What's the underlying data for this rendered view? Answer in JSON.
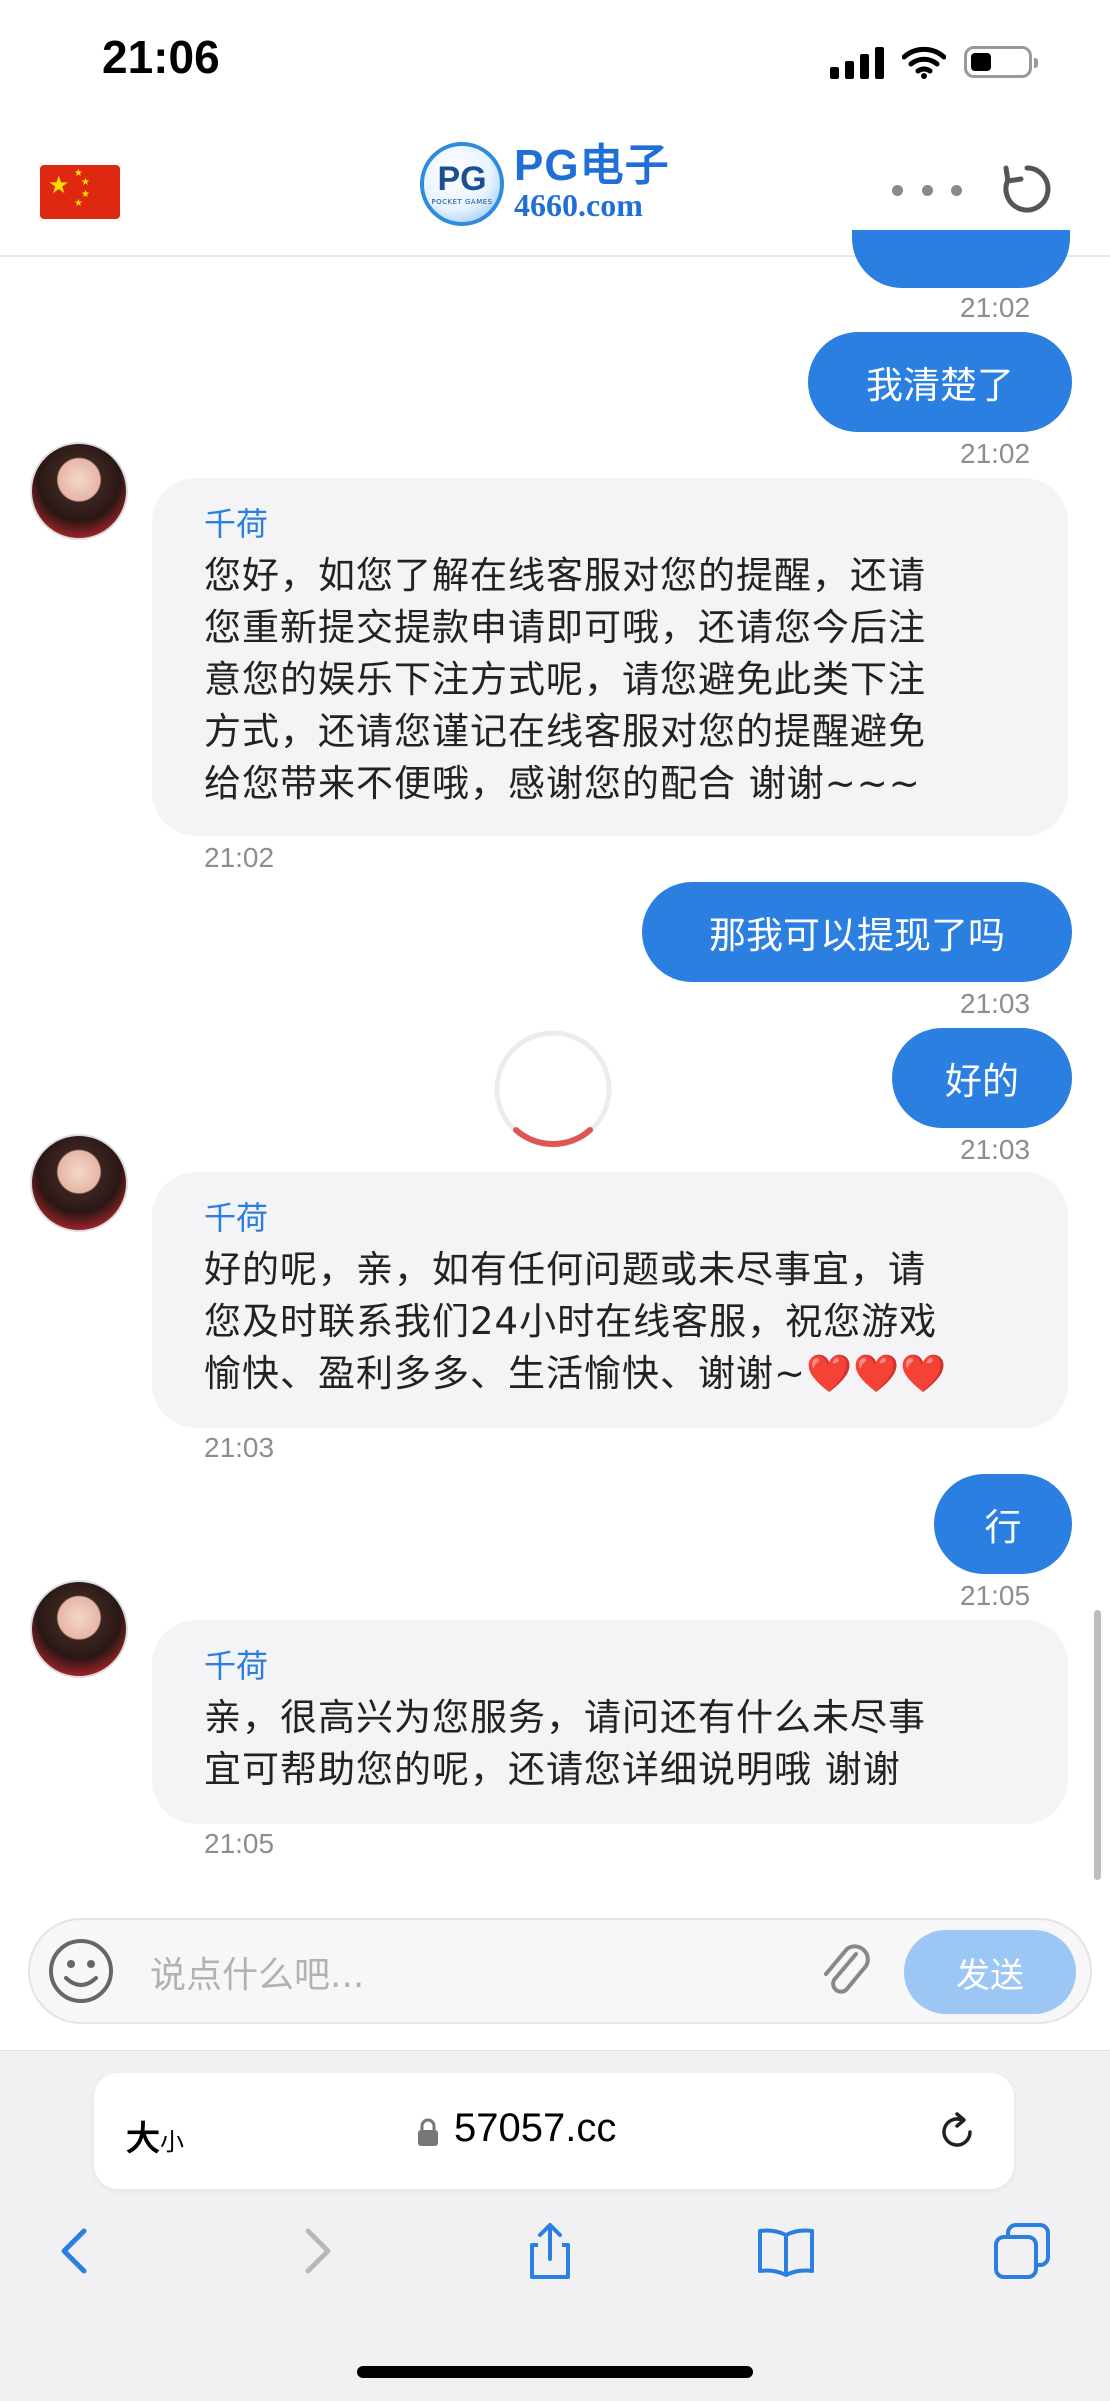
{
  "status_bar": {
    "time": "21:06"
  },
  "header": {
    "flag_icon": "china-flag-icon",
    "logo_badge": "PG",
    "logo_badge_sub": "POCKET GAMES",
    "logo_title": "PG电子",
    "logo_domain": "4660.com"
  },
  "messages": [
    {
      "type": "outgoing",
      "text": "",
      "time": "21:02"
    },
    {
      "type": "outgoing",
      "text": "我清楚了",
      "time": "21:02"
    },
    {
      "type": "incoming",
      "name": "千荷",
      "lines": [
        "您好，如您了解在线客服对您的提醒，还请",
        "您重新提交提款申请即可哦，还请您今后注",
        "意您的娱乐下注方式呢，请您避免此类下注",
        "方式，还请您谨记在线客服对您的提醒避免",
        "给您带来不便哦，感谢您的配合 谢谢~~~"
      ],
      "time": "21:02"
    },
    {
      "type": "outgoing",
      "text": "那我可以提现了吗",
      "time": "21:03"
    },
    {
      "type": "outgoing",
      "text": "好的",
      "time": "21:03"
    },
    {
      "type": "incoming",
      "name": "千荷",
      "lines": [
        "好的呢，亲，如有任何问题或未尽事宜，请",
        "您及时联系我们24小时在线客服，祝您游戏",
        "愉快、盈利多多、生活愉快、谢谢~❤️❤️❤️"
      ],
      "time": "21:03"
    },
    {
      "type": "outgoing",
      "text": "行",
      "time": "21:05"
    },
    {
      "type": "incoming",
      "name": "千荷",
      "lines": [
        "亲，很高兴为您服务，请问还有什么未尽事",
        "宜可帮助您的呢，还请您详细说明哦 谢谢"
      ],
      "time": "21:05"
    }
  ],
  "input": {
    "placeholder": "说点什么吧...",
    "send_label": "发送"
  },
  "browser": {
    "text_size_label": "大",
    "text_size_small": "小",
    "url": "57057.cc"
  },
  "colors": {
    "accent": "#2a7fe0",
    "send_disabled": "#9cc6f3",
    "incoming_bg": "#f4f4f6"
  }
}
